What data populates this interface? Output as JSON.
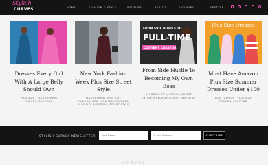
{
  "header": {
    "logo_script": "Stylish",
    "logo_caps": "CURVES",
    "nav": [
      "HOME",
      "FASHION & STYLE",
      "YOUTUBE",
      "BEAUTY",
      "SHOPPING",
      "LIFESTYLE"
    ],
    "social_icons": [
      "instagram-icon",
      "pinterest-icon",
      "facebook-icon",
      "youtube-icon",
      "twitter-icon"
    ]
  },
  "colors": {
    "accent": "#e94fa8",
    "dark": "#141414",
    "background": "#f4f4f4"
  },
  "cards": [
    {
      "title": "Dresses Every Girl With A Large Belly Should Own",
      "tags": "PLUS SIZE / PLUS FASHION\nFASHION, SHOPPING"
    },
    {
      "title": "New York Fashion Week Plus Size Street Style",
      "tags": "PLUS FASHION, PLUS SIZE\nFASHION, NEW YORK FASHION WEEK\nPLUS SIZE BLOGGERS, STREET STYLE"
    },
    {
      "title": "From Side Hustle To Becoming My Own Boss",
      "tags": "BLOGGING TIPS, CAREER, LATEST\nENTREPRENEUR SPOTLIGHT, SHOPPING",
      "image_overlay": {
        "line1": "FROM SIDE HUSTLE TO",
        "line2": "FULL-TIME",
        "line3": "CONTENT CREATOR"
      }
    },
    {
      "title": "Must Have Amazon Plus Size Summer Dresses Under $100",
      "tags": "PLUS FASHION / PLUS SIZE\nFASHION, SHOPPING",
      "image_overlay": {
        "line1": "Plus Size Dresses"
      }
    }
  ],
  "newsletter": {
    "label": "STYLISH CURVES NEWSLETTER",
    "first_name_placeholder": "First Name",
    "email_placeholder": "E-Mail Address",
    "button": "SUBSCRIBE"
  },
  "footer": {
    "hint": "CURVES"
  }
}
